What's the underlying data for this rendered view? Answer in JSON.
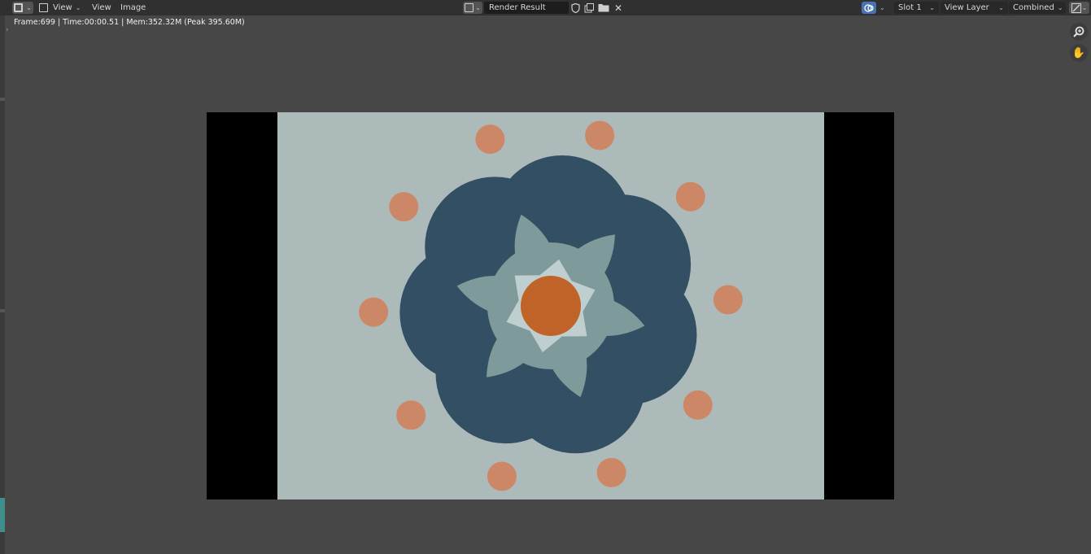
{
  "header": {
    "view_menu_1": "View",
    "view_menu_2": "View",
    "image_menu": "Image",
    "image_name": "Render Result",
    "slot": "Slot 1",
    "view_layer": "View Layer",
    "pass": "Combined"
  },
  "status": {
    "text": "Frame:699 | Time:00:00.51 | Mem:352.32M (Peak 395.60M)"
  },
  "icons": {
    "editor_type": "image-editor-icon",
    "mode": "view-mode-icon",
    "browse_image": "image-browse-icon",
    "fake_user": "shield-icon",
    "new_image": "new-image-icon",
    "open_image": "folder-icon",
    "unlink": "close-icon",
    "display_channels": "display-channels-icon",
    "zoom": "zoom-icon",
    "pan": "hand-icon",
    "sidebar_toggle": "sidebar-toggle-icon"
  },
  "colors": {
    "background": "#474747",
    "header": "#303030",
    "render_bg": "#adbaba",
    "outer_petals": "#324f63",
    "inner_petals": "#7e9a9a",
    "star": "#bfcfd0",
    "center": "#c06328",
    "dots": "#cc8767"
  }
}
